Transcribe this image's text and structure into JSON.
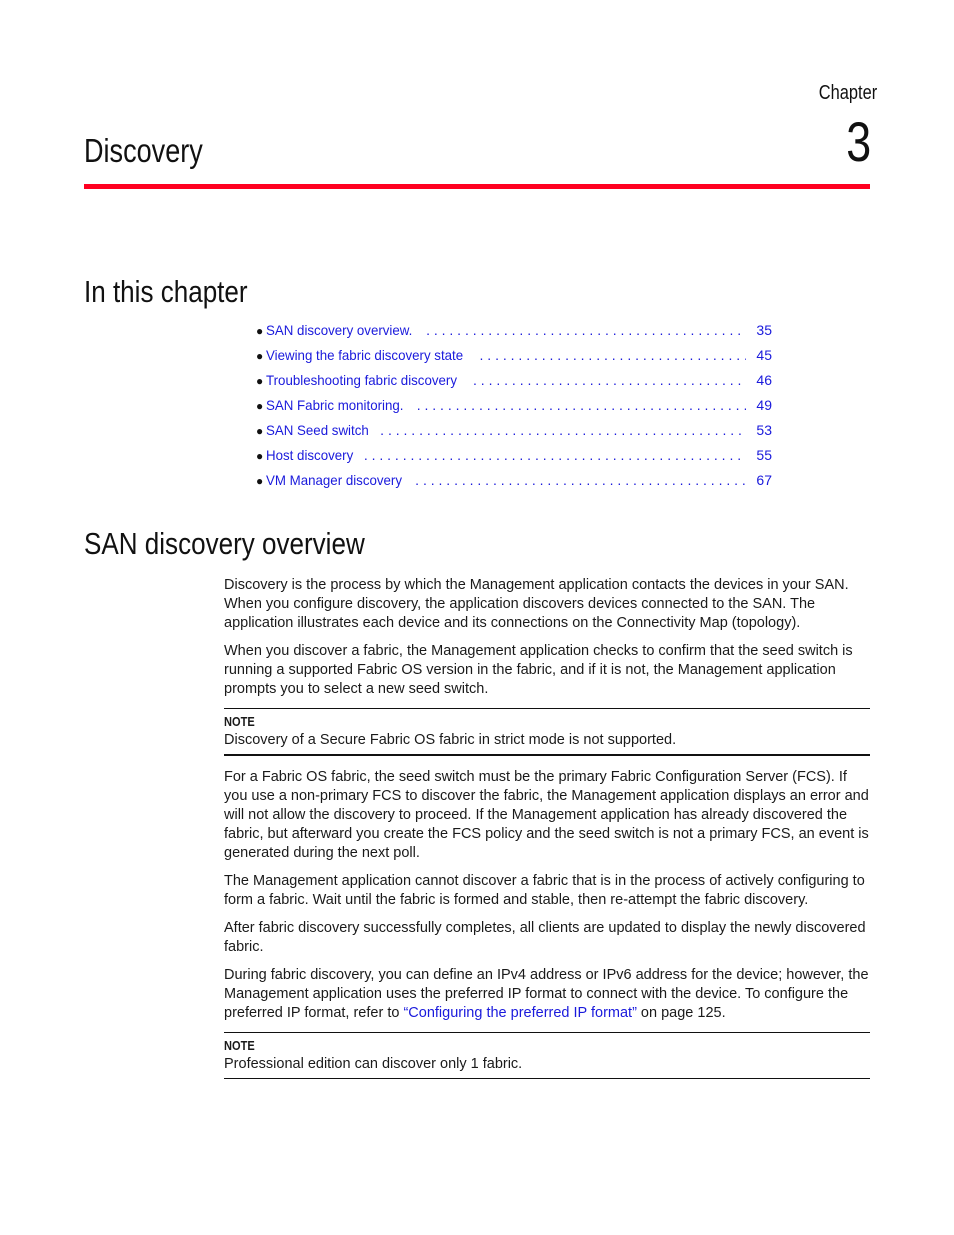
{
  "header": {
    "chapter_label": "Chapter",
    "chapter_number": "3",
    "chapter_title": "Discovery",
    "rule_color": "#ff0020"
  },
  "in_this_chapter": {
    "heading": "In this chapter",
    "items": [
      {
        "title": "SAN discovery overview.",
        "page": "35"
      },
      {
        "title": "Viewing the fabric discovery state",
        "page": "45"
      },
      {
        "title": "Troubleshooting fabric discovery",
        "page": "46"
      },
      {
        "title": "SAN Fabric monitoring.",
        "page": "49"
      },
      {
        "title": "SAN Seed switch",
        "page": "53"
      },
      {
        "title": "Host discovery",
        "page": "55"
      },
      {
        "title": "VM Manager discovery",
        "page": "67"
      }
    ]
  },
  "section": {
    "heading": "SAN discovery overview",
    "p1": "Discovery is the process by which the Management application contacts the devices in your SAN. When you configure discovery, the application discovers devices connected to the SAN. The application illustrates each device and its connections on the Connectivity Map (topology).",
    "p2": "When you discover a fabric, the Management application checks to confirm that the seed switch is running a supported Fabric OS version in the fabric, and if it is not, the Management application prompts you to select a new seed switch.",
    "note1": {
      "label": "NOTE",
      "text": "Discovery of a Secure Fabric OS fabric in strict mode is not supported."
    },
    "p3": "For a Fabric OS fabric, the seed switch must be the primary Fabric Configuration Server (FCS). If you use a non-primary FCS to discover the fabric, the Management application displays an error and will not allow the discovery to proceed. If the Management application has already discovered the fabric, but afterward you create the FCS policy and the seed switch is not a primary FCS, an event is generated during the next poll.",
    "p4": "The Management application cannot discover a fabric that is in the process of actively configuring to form a fabric. Wait until the fabric is formed and stable, then re-attempt the fabric discovery.",
    "p5": "After fabric discovery successfully completes, all clients are updated to display the newly discovered fabric.",
    "p6_before": "During fabric discovery, you can define an IPv4 address or IPv6 address for the device; however, the Management application uses the preferred IP format to connect with the device. To configure the preferred IP format, refer to ",
    "p6_link": "“Configuring the preferred IP format”",
    "p6_after": " on page 125.",
    "note2": {
      "label": "NOTE",
      "text": "Professional edition can discover only 1 fabric."
    }
  },
  "colors": {
    "link": "#1a1adc",
    "text": "#1a1a1a"
  }
}
